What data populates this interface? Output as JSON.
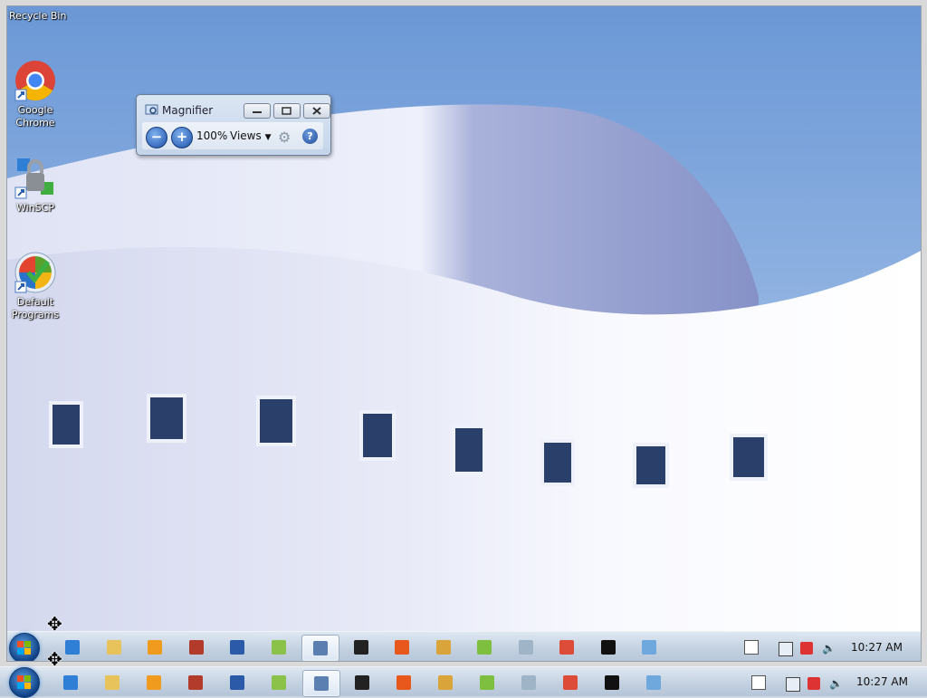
{
  "desktop": {
    "recycle_bin_label": "Recycle Bin",
    "icons": [
      {
        "label": "Google Chrome",
        "icon": "chrome-icon"
      },
      {
        "label": "WinSCP",
        "icon": "winscp-icon"
      },
      {
        "label": "Default Programs",
        "icon": "default-programs-icon"
      }
    ]
  },
  "magnifier": {
    "title": "Magnifier",
    "zoom": "100%",
    "views_label": "Views",
    "zoom_out_glyph": "−",
    "zoom_in_glyph": "+",
    "help_glyph": "?"
  },
  "taskbar": {
    "clock": "10:27 AM",
    "apps": [
      {
        "name": "internet-explorer",
        "color": "#2f7fd6"
      },
      {
        "name": "windows-explorer",
        "color": "#e8c25a"
      },
      {
        "name": "media-player",
        "color": "#f09a1e"
      },
      {
        "name": "app-icon-4",
        "color": "#b23b2b"
      },
      {
        "name": "powershell",
        "color": "#2a5aa8"
      },
      {
        "name": "notepad",
        "color": "#8bc34a"
      },
      {
        "name": "magnifier",
        "color": "#5a7fb0"
      },
      {
        "name": "7zip",
        "color": "#222222"
      },
      {
        "name": "firefox",
        "color": "#e8581c"
      },
      {
        "name": "paint",
        "color": "#d9a43a"
      },
      {
        "name": "app-icon-11",
        "color": "#7fbf3f"
      },
      {
        "name": "calculator",
        "color": "#a0b4c8"
      },
      {
        "name": "chrome",
        "color": "#dd4b39"
      },
      {
        "name": "cmd",
        "color": "#111111"
      },
      {
        "name": "app-icon-15",
        "color": "#6fa8dc"
      }
    ],
    "tray_icons": [
      "action-center-icon",
      "network-icon",
      "volume-icon"
    ]
  }
}
